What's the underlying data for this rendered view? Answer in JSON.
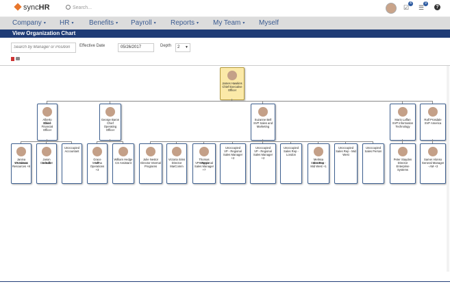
{
  "brand": {
    "name_pre": "sync",
    "name_bold": "HR"
  },
  "search": {
    "placeholder": "Search..."
  },
  "top_icons": {
    "tasks_count": "4",
    "messages_count": "9",
    "help_label": "?"
  },
  "nav": {
    "items": [
      {
        "label": "Company",
        "has_caret": true
      },
      {
        "label": "HR",
        "has_caret": true
      },
      {
        "label": "Benefits",
        "has_caret": true
      },
      {
        "label": "Payroll",
        "has_caret": true
      },
      {
        "label": "Reports",
        "has_caret": true
      },
      {
        "label": "My Team",
        "has_caret": true
      },
      {
        "label": "Myself",
        "has_caret": false
      }
    ]
  },
  "page": {
    "title": "View Organization Chart"
  },
  "filters": {
    "search_placeholder": "Search by Manager or Position",
    "effective_date_label": "Effective Date",
    "effective_date_value": "05/26/2017",
    "depth_label": "Depth",
    "depth_value": "2"
  },
  "org": {
    "ceo": {
      "name": "James Hawkins",
      "title": "Chief Executive Officer"
    },
    "level1": [
      {
        "name": "Alberto Blaine",
        "title": "Chief Financial Officer"
      },
      {
        "name": "George Baron",
        "title": "Chief Operating Officer"
      },
      {
        "name": "Suzanne Bell",
        "title": "SVP Sales and Marketing"
      },
      {
        "name": "Mario Laffan",
        "title": "SVP Information Technology"
      },
      {
        "name": "Ralf Prosdale",
        "title": "SVP America"
      }
    ],
    "level2": [
      {
        "name": "Janina Cazalmos",
        "title": "VP Human Resources +8"
      },
      {
        "name": "Jason Schultz",
        "title": "Controller"
      },
      {
        "name": "Unoccupied",
        "title": "Accountant",
        "unoccupied": true
      },
      {
        "name": "Grace Medina",
        "title": "VP Operations +3"
      },
      {
        "name": "William Hedge",
        "title": "CS Assistant"
      },
      {
        "name": "Julie Nestor",
        "title": "Director Internal Programs"
      },
      {
        "name": "Victoria Sims",
        "title": "Director MarComm"
      },
      {
        "name": "Thomas Wagner",
        "title": "VP - Regional Sales Manager +7"
      },
      {
        "name": "Unoccupied",
        "title": "VP - Regional Sales Manager +2",
        "unoccupied": true
      },
      {
        "name": "Unoccupied",
        "title": "VP - Regional Sales Manager +2",
        "unoccupied": true
      },
      {
        "name": "Unoccupied",
        "title": "Sales Rep - London",
        "unoccupied": true
      },
      {
        "name": "Melissa Montana",
        "title": "Sales Rep - Mid West +1"
      },
      {
        "name": "Unoccupied",
        "title": "Sales Rep - Mid West",
        "unoccupied": true
      },
      {
        "name": "Unoccupied",
        "title": "Sales Person",
        "unoccupied": true
      },
      {
        "name": "Peter Stayden",
        "title": "Director Enterprise Systems"
      },
      {
        "name": "Samer Alonso",
        "title": "General Manager - AM +3"
      }
    ]
  }
}
